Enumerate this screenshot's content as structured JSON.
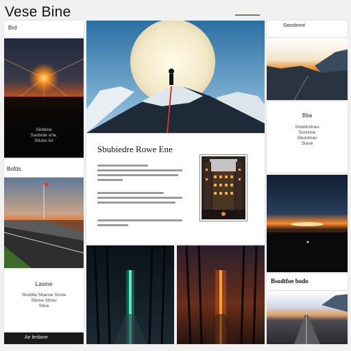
{
  "header": {
    "site_title": "Vese Bine"
  },
  "left_column": {
    "top_label": "Brd",
    "sunset_caption": [
      "Slotbine",
      "Sanbote orla.",
      "Shubs lor"
    ],
    "mid_label": "Bofds.",
    "bottom_card_title": "Lasine",
    "bottom_card_text": [
      "Shubtle Sbanse Sonie",
      "Sbone Sthou",
      "Silne"
    ],
    "bottom_bar_text": "Ae lenbore"
  },
  "middle_column": {
    "article_heading": "Sbubiedre Rowe Ene"
  },
  "right_column": {
    "top_label": "Saonbmot",
    "mid_title": "Bba",
    "mid_text": [
      "Snlobtstines",
      "Sonlsine",
      "Sbulotnan",
      "Siane"
    ],
    "caption": "Bsodtfoe bodo"
  },
  "colors": {
    "page_bg": "#f1f1f1",
    "card_bg": "#ffffff",
    "sunset_orange": "#ff7a1a",
    "sky_blue": "#2a6fa3"
  }
}
